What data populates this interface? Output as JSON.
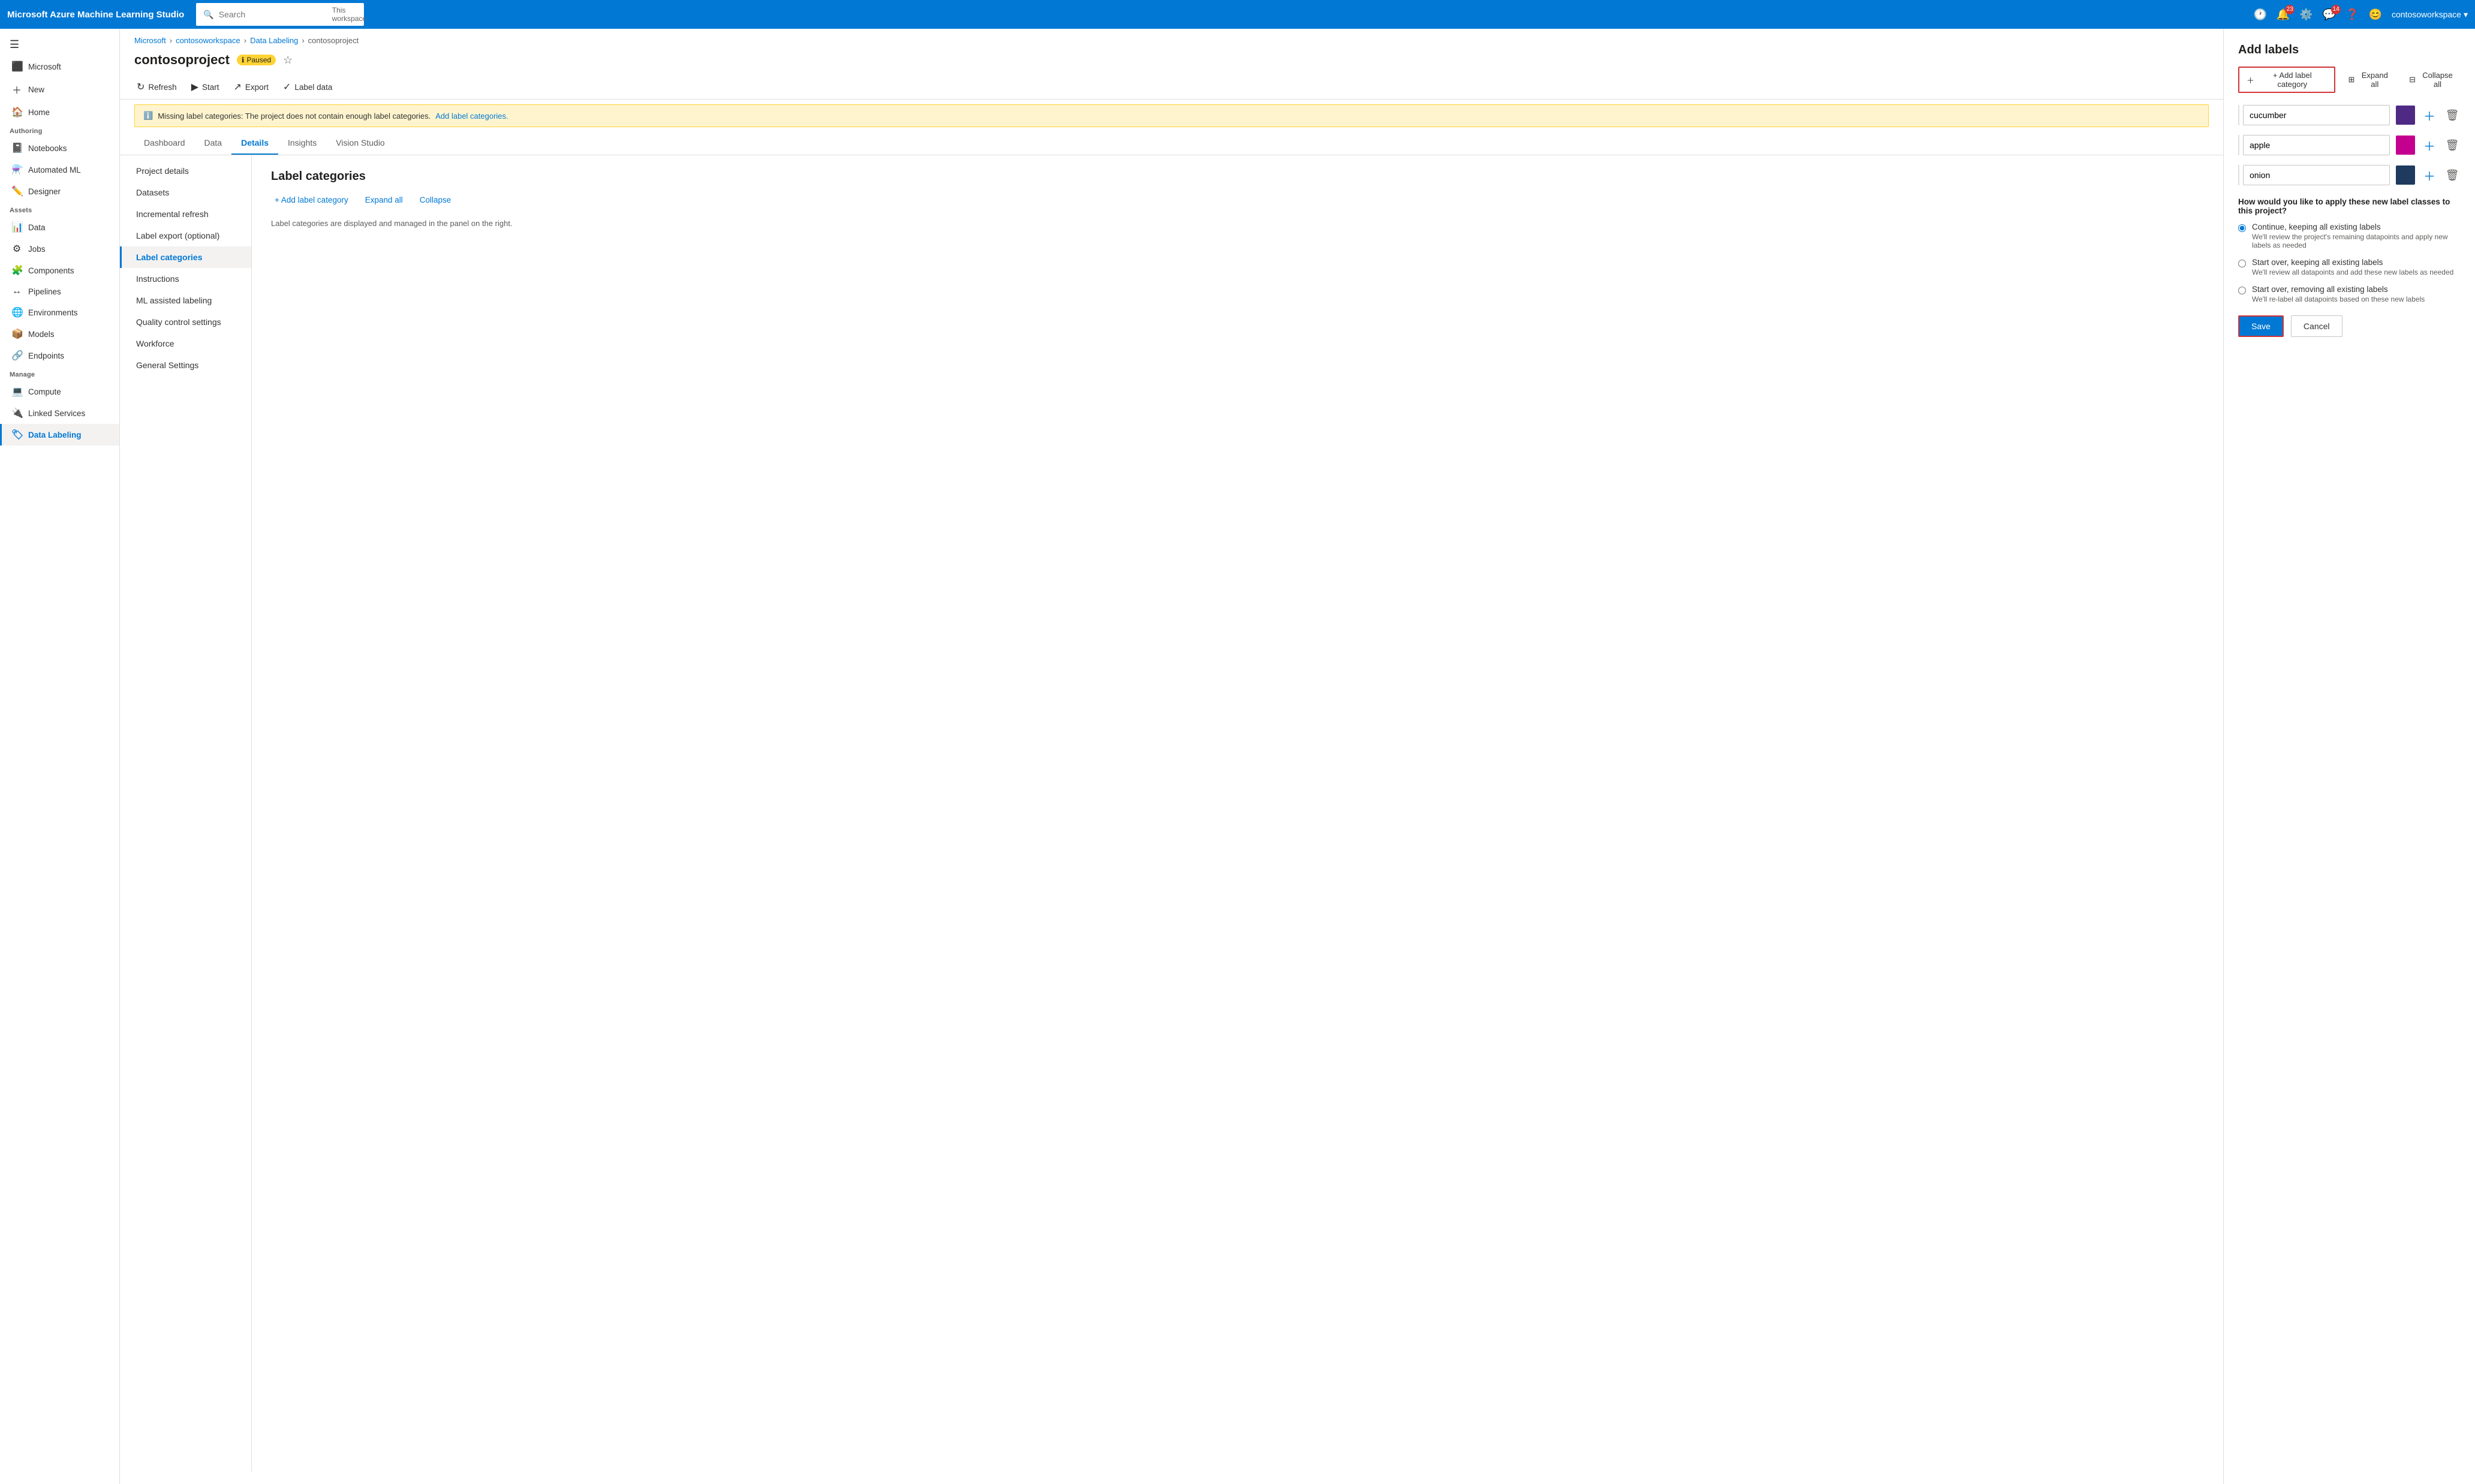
{
  "app": {
    "brand": "Microsoft Azure Machine Learning Studio",
    "search_placeholder": "Search",
    "workspace_label": "This workspace"
  },
  "topbar": {
    "icons": [
      "history",
      "bell",
      "settings",
      "feedback",
      "help",
      "smiley"
    ],
    "bell_badge": "23",
    "feedback_badge": "14",
    "user": "contosoworkspace"
  },
  "sidebar": {
    "menu_icon": "☰",
    "microsoft_label": "Microsoft",
    "new_label": "New",
    "home_label": "Home",
    "authoring_label": "Authoring",
    "notebooks_label": "Notebooks",
    "automated_ml_label": "Automated ML",
    "designer_label": "Designer",
    "assets_label": "Assets",
    "data_label": "Data",
    "jobs_label": "Jobs",
    "components_label": "Components",
    "pipelines_label": "Pipelines",
    "environments_label": "Environments",
    "models_label": "Models",
    "endpoints_label": "Endpoints",
    "manage_label": "Manage",
    "compute_label": "Compute",
    "linked_services_label": "Linked Services",
    "data_labeling_label": "Data Labeling"
  },
  "breadcrumb": {
    "items": [
      "Microsoft",
      "contosoworkspace",
      "Data Labeling",
      "contosoproject"
    ]
  },
  "page": {
    "title": "contosoproject",
    "status": "Paused",
    "toolbar": {
      "refresh": "Refresh",
      "start": "Start",
      "export": "Export",
      "label_data": "Label data"
    },
    "warning": {
      "message": "Missing label categories: The project does not contain enough label categories.",
      "link_text": "Add label categories."
    }
  },
  "tabs": [
    "Dashboard",
    "Data",
    "Details",
    "Insights",
    "Vision Studio"
  ],
  "active_tab": "Details",
  "left_nav": [
    "Project details",
    "Datasets",
    "Incremental refresh",
    "Label export (optional)",
    "Label categories",
    "Instructions",
    "ML assisted labeling",
    "Quality control settings",
    "Workforce",
    "General Settings"
  ],
  "active_nav": "Label categories",
  "content": {
    "section_title": "Label categories",
    "add_label_category": "+ Add label category",
    "expand_all": "Expand all",
    "collapse_all": "Collapse"
  },
  "panel": {
    "title": "Add labels",
    "add_label_btn": "+ Add label category",
    "expand_all_btn": "Expand all",
    "collapse_all_btn": "Collapse all",
    "labels": [
      {
        "value": "cucumber",
        "color": "#4e2a84"
      },
      {
        "value": "apple",
        "color": "#c4008f"
      },
      {
        "value": "onion",
        "color": "#1e3a5f"
      }
    ],
    "apply_question": "How would you like to apply these new label classes to this project?",
    "options": [
      {
        "id": "continue",
        "label": "Continue, keeping all existing labels",
        "desc": "We'll review the project's remaining datapoints and apply new labels as needed",
        "selected": true
      },
      {
        "id": "startover-keep",
        "label": "Start over, keeping all existing labels",
        "desc": "We'll review all datapoints and add these new labels as needed",
        "selected": false
      },
      {
        "id": "startover-remove",
        "label": "Start over, removing all existing labels",
        "desc": "We'll re-label all datapoints based on these new labels",
        "selected": false
      }
    ],
    "save_btn": "Save",
    "cancel_btn": "Cancel"
  }
}
